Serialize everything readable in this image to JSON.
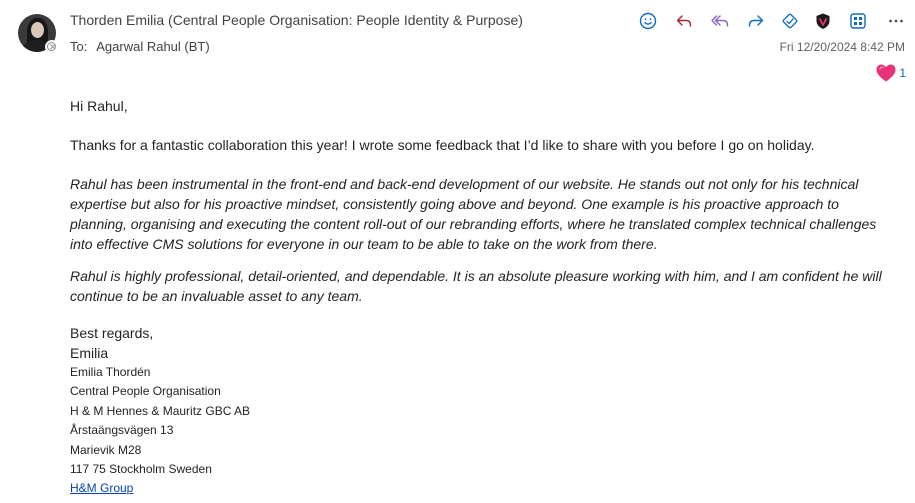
{
  "header": {
    "sender": "Thorden Emilia (Central People Organisation: People Identity & Purpose)",
    "to_label": "To:",
    "recipient": "Agarwal Rahul (BT)",
    "date": "Fri 12/20/2024 8:42 PM"
  },
  "toolbar": {
    "icons": [
      "emoji-icon",
      "reply-icon",
      "reply-all-icon",
      "forward-icon",
      "apps-icon",
      "shield-icon",
      "grid-view-icon",
      "more-icon"
    ]
  },
  "reaction": {
    "icon": "heart-icon",
    "count": "1",
    "color": "#e8337a"
  },
  "message": {
    "greeting": "Hi Rahul,",
    "p1": "Thanks for a fantastic collaboration this year! I wrote some feedback that I’d like to share with you before I go on holiday.",
    "p2": "Rahul has been instrumental in the front-end and back-end development of our website. He stands out not only for his technical expertise but also for his proactive mindset, consistently going above and beyond. One example is his proactive approach to planning, organising and executing the content roll-out of our rebranding efforts, where he translated complex technical challenges into effective CMS solutions for everyone in our team to be able to take on the work from there.",
    "p3": "Rahul is highly professional, detail-oriented, and dependable. It is an absolute pleasure working with him, and I am confident he will continue to be an invaluable asset to any team.",
    "closing": "Best regards,",
    "signoff": "Emilia"
  },
  "signature": {
    "lines": [
      "Emilia Thordén",
      "Central People Organisation",
      "H & M Hennes & Mauritz GBC AB",
      "Årstaängsvägen 13",
      "Marievik M28",
      "117 75 Stockholm Sweden"
    ],
    "link": "H&M Group"
  }
}
